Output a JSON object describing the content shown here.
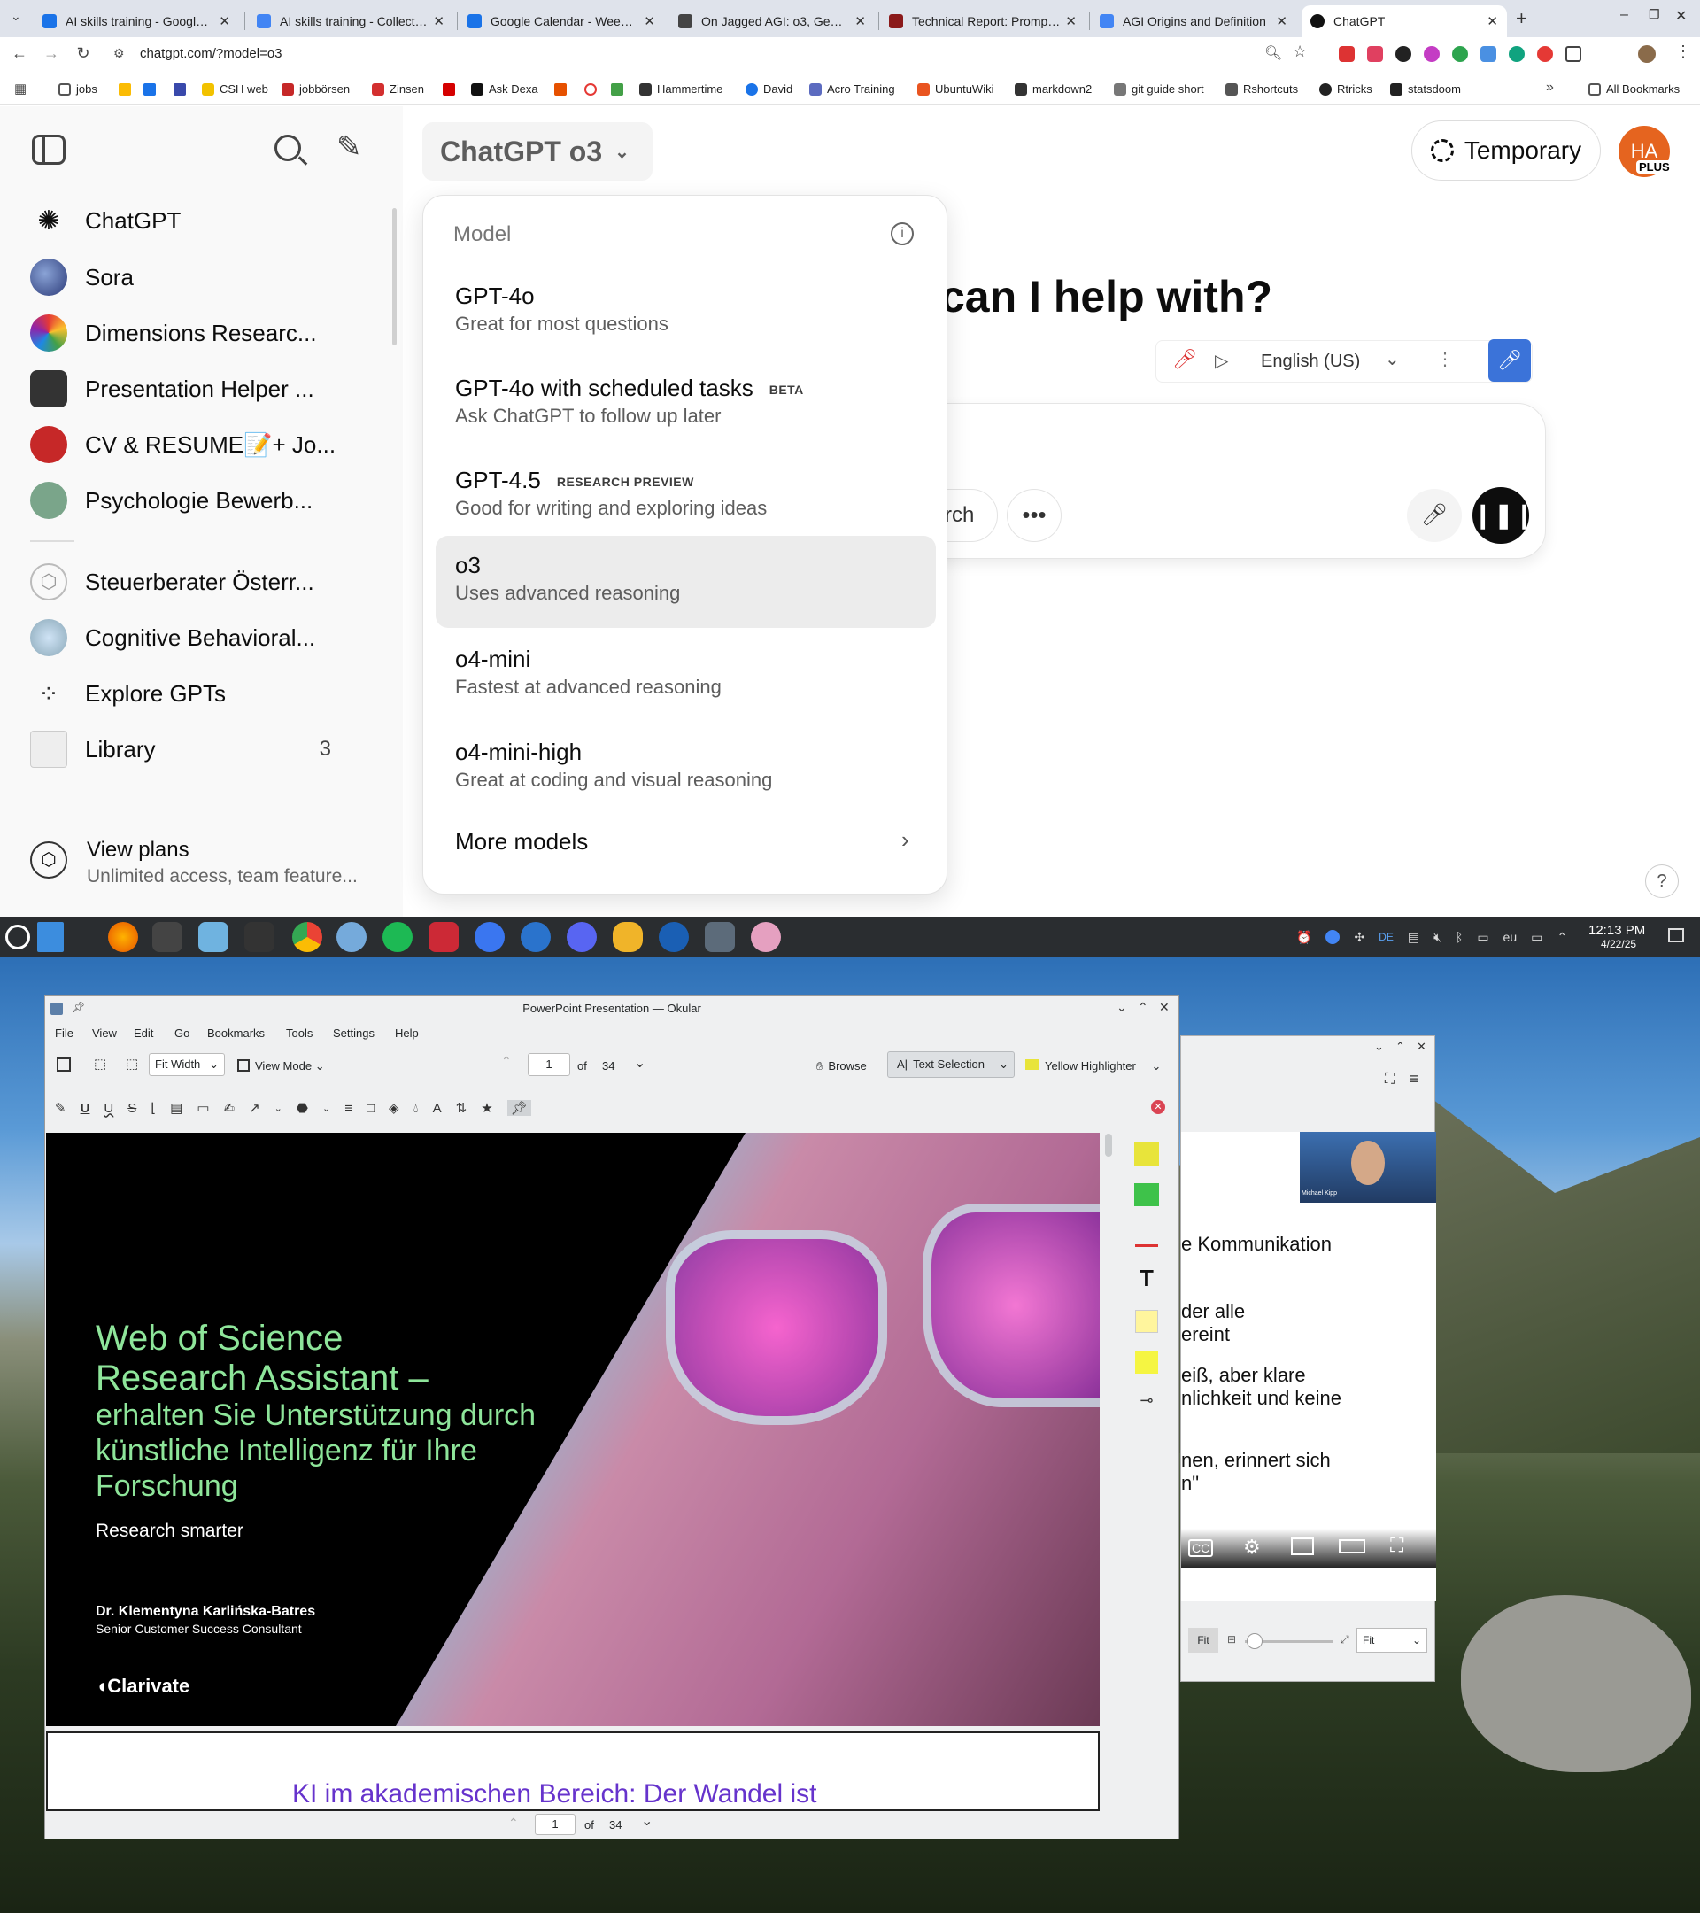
{
  "browser": {
    "tabs": [
      {
        "title": "AI skills training - Google D",
        "fav": "#1a73e8"
      },
      {
        "title": "AI skills training - Collection",
        "fav": "#4285f4"
      },
      {
        "title": "Google Calendar - Week of",
        "fav": "#1a73e8"
      },
      {
        "title": "On Jagged AGI: o3, Gemini",
        "fav": "#444444"
      },
      {
        "title": "Technical Report: Prompt E",
        "fav": "#8b1a1a"
      },
      {
        "title": "AGI Origins and Definition",
        "fav": "#4285f4"
      },
      {
        "title": "ChatGPT",
        "fav": "#111111"
      }
    ],
    "url": "chatgpt.com/?model=o3",
    "bookmarks": [
      "jobs",
      "CSH web",
      "jobbörsen",
      "Zinsen",
      "Ask Dexa",
      "Hammertime",
      "David",
      "Acro Training",
      "UbuntuWiki",
      "markdown2",
      "git guide short",
      "Rshortcuts",
      "Rtricks",
      "statsdoom",
      "All Bookmarks"
    ]
  },
  "sidebar": {
    "items": [
      {
        "label": "ChatGPT",
        "icon": "openai-icon"
      },
      {
        "label": "Sora",
        "icon": "sora-icon"
      },
      {
        "label": "Dimensions Researc...",
        "icon": "dimensions-icon"
      },
      {
        "label": "Presentation Helper ...",
        "icon": "presentation-icon"
      },
      {
        "label": "CV & RESUME📝+ Jo...",
        "icon": "cv-icon"
      },
      {
        "label": "Psychologie Bewerb...",
        "icon": "psychology-icon"
      },
      {
        "label": "Steuerberater Österr...",
        "icon": "cube-icon"
      },
      {
        "label": "Cognitive Behavioral...",
        "icon": "cbt-icon"
      },
      {
        "label": "Explore GPTs",
        "icon": "grid-icon"
      },
      {
        "label": "Library",
        "icon": "library-icon"
      }
    ],
    "library_count": "3",
    "view_plans": {
      "title": "View plans",
      "subtitle": "Unlimited access, team feature..."
    }
  },
  "main": {
    "model_button": "ChatGPT o3",
    "temporary": "Temporary",
    "avatar": "HA",
    "plus_badge": "PLUS",
    "heading": "can I help with?",
    "language": "English (US)",
    "composer_partial": "rch"
  },
  "dropdown": {
    "header": "Model",
    "options": [
      {
        "title": "GPT-4o",
        "badge": "",
        "desc": "Great for most questions"
      },
      {
        "title": "GPT-4o with scheduled tasks",
        "badge": "BETA",
        "desc": "Ask ChatGPT to follow up later"
      },
      {
        "title": "GPT-4.5",
        "badge": "RESEARCH PREVIEW",
        "desc": "Good for writing and exploring ideas"
      },
      {
        "title": "o3",
        "badge": "",
        "desc": "Uses advanced reasoning"
      },
      {
        "title": "o4-mini",
        "badge": "",
        "desc": "Fastest at advanced reasoning"
      },
      {
        "title": "o4-mini-high",
        "badge": "",
        "desc": "Great at coding and visual reasoning"
      }
    ],
    "more": "More models",
    "selected_index": 3
  },
  "taskbar": {
    "time": "12:13 PM",
    "date": "4/22/25",
    "lang": "DE",
    "kb": "eu"
  },
  "okular": {
    "title": "PowerPoint Presentation — Okular",
    "menu": [
      "File",
      "View",
      "Edit",
      "Go",
      "Bookmarks",
      "Tools",
      "Settings",
      "Help"
    ],
    "zoom": "Fit Width",
    "view_mode": "View Mode",
    "page": "1",
    "of": "of",
    "total": "34",
    "browse": "Browse",
    "text_selection": "Text Selection",
    "highlighter": "Yellow Highlighter",
    "slide": {
      "title_lines": [
        "Web of Science",
        "Research Assistant –"
      ],
      "subtitle_lines": [
        "erhalten Sie Unterstützung durch",
        "künstliche Intelligenz für Ihre",
        "Forschung"
      ],
      "tagline": "Research smarter",
      "author": "Dr. Klementyna Karlińska-Batres",
      "role": "Senior Customer Success Consultant",
      "brand": "Clarivate"
    },
    "slide2_title": "KI im akademischen Bereich: Der Wandel ist"
  },
  "video": {
    "presenter": "Michael Kipp",
    "lines": [
      "e Kommunikation",
      "der alle",
      "ereint",
      "eiß, aber klare",
      "nlichkeit und keine",
      "nen, erinnert sich",
      "n\""
    ],
    "fit": "Fit",
    "fit_select": "Fit"
  },
  "colors": {
    "accent": "#1a73e8",
    "slide_green": "#8ee59a",
    "slide2_purple": "#6633cc",
    "voice": "#3b73d9"
  }
}
